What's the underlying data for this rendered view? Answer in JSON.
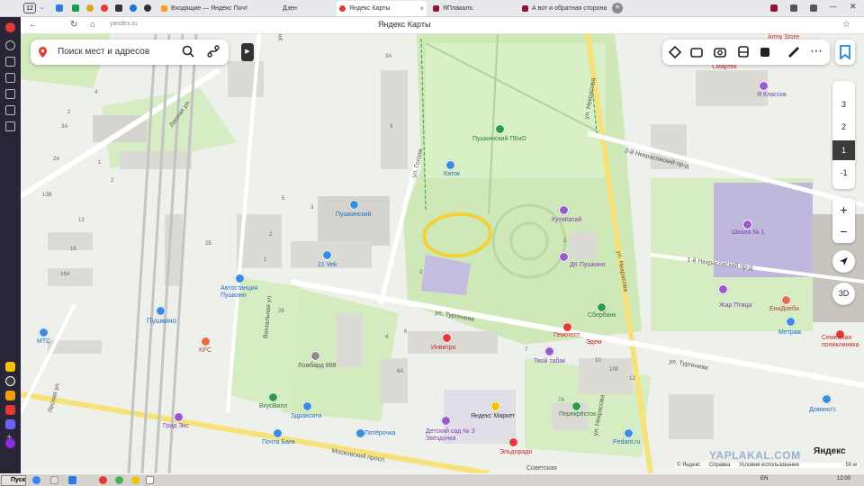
{
  "browser": {
    "tab_counter": "12",
    "tabs": [
      {
        "label": "Входящие — Яндекс Почт",
        "color": "#f4a21b"
      },
      {
        "label": "Дзен",
        "color": "#333333"
      },
      {
        "label": "Яндекс Карты",
        "color": "#e53935"
      },
      {
        "label": "ЯПлакалъ",
        "color": "#8e1538"
      },
      {
        "label": "А вот и обратная сторона",
        "color": "#8e1538"
      }
    ],
    "address_host": "yandex.ru",
    "page_title": "Яндекс Карты"
  },
  "search": {
    "placeholder": "Поиск мест и адресов"
  },
  "floors": [
    "3",
    "2",
    "1",
    "-1"
  ],
  "active_floor": "1",
  "controls": {
    "zoom_in": "+",
    "zoom_out": "−",
    "three_d": "3D"
  },
  "map_labels": {
    "streets": {
      "turgeneva1": "ул. Тургенева",
      "turgeneva2": "ул. Тургенева",
      "nekrasova1": "ул. Некрасова",
      "nekrasova2": "ул. Некрасова",
      "nekrasova3": "ул. Некрасова",
      "nekrasovsky2": "2-й Некрасовский пр-д",
      "nekrasovsky1": "1-й Некрасовский пр-д",
      "gogolya": "ул. Гоголя",
      "vokzalnaya": "Вокзальная ул.",
      "moskovsky": "Московский просп.",
      "lesnaya1": "Лесная ул.",
      "lesnaya2": "Лесная ул.",
      "ul_top": "ул"
    },
    "places": {
      "park": "Пушкинский ПКиО",
      "katok": "Каток",
      "pushkinsky": "Пушкинский",
      "vek21": "21 Vek",
      "kutikatay": "КутиКатай",
      "dk": "ДК Пушкино",
      "bus_station": "Автостанция Пушкино",
      "pushkino": "Пушкино",
      "mts": "МТС",
      "kfc": "KFC",
      "lombard": "Ломбард 888",
      "vkusvill": "ВкусВилл",
      "zdravsity": "Здравсити",
      "grid_eks": "Грид Экс",
      "pochta": "Почта Банк",
      "pyaterochka": "Пятёрочка",
      "invitro": "Инвитро",
      "tvoy_tabak": "Твой табак",
      "gemotest": "Гемотест",
      "edem": "Эдем",
      "sberbank": "Сбербанк",
      "yandex_market": "Яндекс Маркет",
      "detsky_sad": "Детский сад № 3 Звёздочка",
      "perekrestok": "Перекрёсток",
      "pedant": "Pedant.ru",
      "eldorado": "Эльдорадо",
      "sovetskaya": "Советская",
      "shkola": "Школа № 1",
      "zhar_ptitsa": "Жар Птица",
      "ya_klassik": "Я Классик",
      "eni_doebi": "ЕниДоеби",
      "metrazh": "Метраж",
      "dominos": "Домино'с",
      "semeynaya": "Семейная поликлиника",
      "smartex": "Смартек",
      "army": "Army Store"
    },
    "houses": [
      "3А",
      "3",
      "2",
      "4",
      "3А",
      "2А",
      "1",
      "2",
      "13В",
      "13",
      "16",
      "16А",
      "26",
      "2Б",
      "5",
      "3",
      "2",
      "1",
      "4",
      "6",
      "7",
      "6А",
      "7А",
      "10",
      "10б",
      "12",
      "3",
      "2"
    ]
  },
  "brand": "Яндекс",
  "watermark": "YAPLAKAL.COM",
  "footer": {
    "copyright": "© Яндекс",
    "help": "Справка",
    "terms": "Условия использования",
    "scale": "50 м"
  },
  "taskbar": {
    "start": "Пуск",
    "lang": "EN",
    "clock": "12:00"
  },
  "colors": {
    "park_green": "#c9e6b0",
    "building": "#dcdad4",
    "road_main": "#ffffff",
    "road_yellow": "#f7e27a",
    "rail": "#bdbdbd",
    "highlight": "#f2d13a",
    "school_purple": "#bfb8dc"
  }
}
